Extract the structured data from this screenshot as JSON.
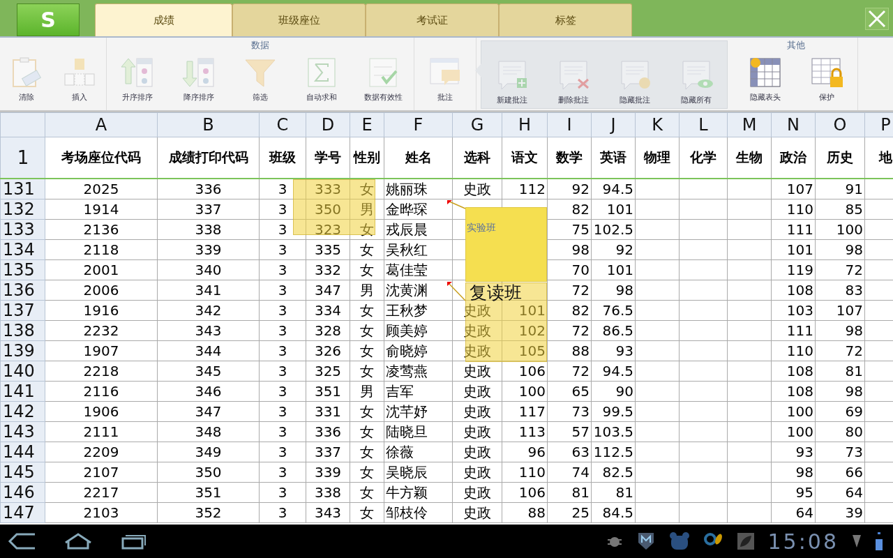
{
  "app_button": {
    "label": "S"
  },
  "tabs": [
    {
      "label": "成绩",
      "selected": true
    },
    {
      "label": "班级座位",
      "selected": false
    },
    {
      "label": "考试证",
      "selected": false
    },
    {
      "label": "标签",
      "selected": false
    }
  ],
  "toolbar": {
    "groups": [
      {
        "items": [
          {
            "label": "清除",
            "disabled": true
          },
          {
            "label": "插入",
            "disabled": true
          }
        ]
      },
      {
        "title": "数据",
        "items": [
          {
            "label": "升序排序",
            "disabled": true
          },
          {
            "label": "降序排序",
            "disabled": true
          },
          {
            "label": "筛选",
            "disabled": true
          },
          {
            "label": "自动求和",
            "disabled": true
          },
          {
            "label": "数据有效性",
            "disabled": true
          }
        ]
      },
      {
        "items": [
          {
            "label": "批注",
            "disabled": true
          }
        ]
      },
      {
        "kind": "popout",
        "items": [
          {
            "label": "新建批注",
            "disabled": true
          },
          {
            "label": "删除批注",
            "disabled": true
          },
          {
            "label": "隐藏批注",
            "disabled": true
          },
          {
            "label": "隐藏所有",
            "disabled": true
          }
        ]
      },
      {
        "title": "其他",
        "items": [
          {
            "label": "隐藏表头",
            "disabled": false
          },
          {
            "label": "保护",
            "disabled": false
          }
        ]
      }
    ]
  },
  "sheet": {
    "columns": [
      "A",
      "B",
      "C",
      "D",
      "E",
      "F",
      "G",
      "H",
      "I",
      "J",
      "K",
      "L",
      "M",
      "N",
      "O",
      "P"
    ],
    "header_row": {
      "number": "1",
      "cells": [
        "考场座位代码",
        "成绩打印代码",
        "班级",
        "学号",
        "性别",
        "姓名",
        "选科",
        "语文",
        "数学",
        "英语",
        "物理",
        "化学",
        "生物",
        "政治",
        "历史",
        "地"
      ]
    },
    "rows": [
      {
        "number": "131",
        "cells": [
          "2025",
          "336",
          "3",
          "333",
          "女",
          "姚丽珠",
          "史政",
          "112",
          "92",
          "94.5",
          null,
          null,
          null,
          "107",
          "91"
        ]
      },
      {
        "number": "132",
        "cells": [
          "1914",
          "337",
          "3",
          "350",
          "男",
          "金晔琛",
          null,
          null,
          "82",
          "101",
          null,
          null,
          null,
          "110",
          "85"
        ]
      },
      {
        "number": "133",
        "cells": [
          "2136",
          "338",
          "3",
          "323",
          "女",
          "戎辰晨",
          null,
          null,
          "75",
          "102.5",
          null,
          null,
          null,
          "111",
          "100"
        ]
      },
      {
        "number": "134",
        "cells": [
          "2118",
          "339",
          "3",
          "335",
          "女",
          "吴秋红",
          null,
          null,
          "98",
          "92",
          null,
          null,
          null,
          "101",
          "98"
        ]
      },
      {
        "number": "135",
        "cells": [
          "2001",
          "340",
          "3",
          "332",
          "女",
          "葛佳莹",
          null,
          null,
          "70",
          "101",
          null,
          null,
          null,
          "119",
          "72"
        ]
      },
      {
        "number": "136",
        "cells": [
          "2006",
          "341",
          "3",
          "347",
          "男",
          "沈黄渊",
          null,
          null,
          "72",
          "98",
          null,
          null,
          null,
          "108",
          "83"
        ]
      },
      {
        "number": "137",
        "cells": [
          "1916",
          "342",
          "3",
          "334",
          "女",
          "王秋梦",
          "史政",
          "101",
          "82",
          "76.5",
          null,
          null,
          null,
          "103",
          "107"
        ]
      },
      {
        "number": "138",
        "cells": [
          "2232",
          "343",
          "3",
          "328",
          "女",
          "顾美婷",
          "史政",
          "102",
          "72",
          "86.5",
          null,
          null,
          null,
          "111",
          "98"
        ]
      },
      {
        "number": "139",
        "cells": [
          "1907",
          "344",
          "3",
          "326",
          "女",
          "俞晓婷",
          "史政",
          "105",
          "88",
          "93",
          null,
          null,
          null,
          "110",
          "72"
        ]
      },
      {
        "number": "140",
        "cells": [
          "2218",
          "345",
          "3",
          "325",
          "女",
          "凌莺燕",
          "史政",
          "106",
          "72",
          "94.5",
          null,
          null,
          null,
          "108",
          "81"
        ]
      },
      {
        "number": "141",
        "cells": [
          "2116",
          "346",
          "3",
          "351",
          "男",
          "吉军",
          "史政",
          "100",
          "65",
          "90",
          null,
          null,
          null,
          "108",
          "98"
        ]
      },
      {
        "number": "142",
        "cells": [
          "1906",
          "347",
          "3",
          "331",
          "女",
          "沈芊妤",
          "史政",
          "117",
          "73",
          "99.5",
          null,
          null,
          null,
          "100",
          "69"
        ]
      },
      {
        "number": "143",
        "cells": [
          "2111",
          "348",
          "3",
          "336",
          "女",
          "陆晓旦",
          "史政",
          "113",
          "57",
          "103.5",
          null,
          null,
          null,
          "100",
          "80"
        ]
      },
      {
        "number": "144",
        "cells": [
          "2209",
          "349",
          "3",
          "337",
          "女",
          "徐薇",
          "史政",
          "96",
          "63",
          "112.5",
          null,
          null,
          null,
          "93",
          "73"
        ]
      },
      {
        "number": "145",
        "cells": [
          "2107",
          "350",
          "3",
          "339",
          "女",
          "吴晓辰",
          "史政",
          "110",
          "74",
          "82.5",
          null,
          null,
          null,
          "98",
          "66"
        ]
      },
      {
        "number": "146",
        "cells": [
          "2217",
          "351",
          "3",
          "338",
          "女",
          "牛方颖",
          "史政",
          "106",
          "81",
          "81",
          null,
          null,
          null,
          "95",
          "64"
        ]
      },
      {
        "number": "147",
        "cells": [
          "2103",
          "352",
          "3",
          "343",
          "女",
          "邹枝伶",
          "史政",
          "88",
          "25",
          "84.5",
          null,
          null,
          null,
          "64",
          "39"
        ]
      }
    ],
    "comments": [
      {
        "kind": "translucent"
      },
      {
        "kind": "opaque",
        "text": "实验班"
      },
      {
        "kind": "translucent",
        "text": "复读班"
      }
    ]
  },
  "status_bar": {
    "time": "15:08"
  }
}
